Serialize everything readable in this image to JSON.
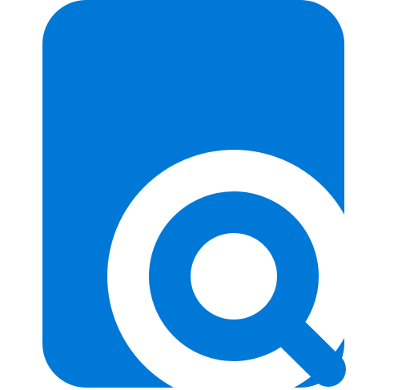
{
  "icon": {
    "name": "document-search-icon",
    "parts": [
      "document-icon",
      "magnifier-icon"
    ]
  },
  "colors": {
    "accent": "#0078D7",
    "background": "#FFFFFF"
  }
}
